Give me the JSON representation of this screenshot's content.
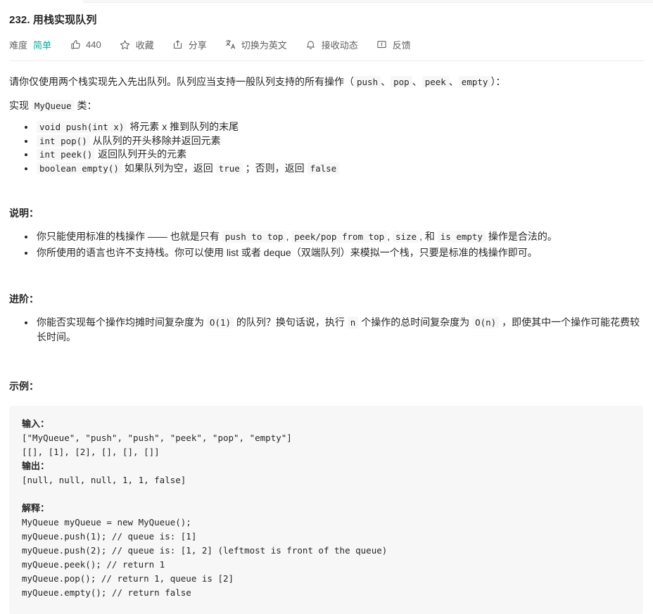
{
  "header": {
    "title": "232. 用栈实现队列",
    "toolbar": {
      "difficulty_label": "难度",
      "difficulty_value": "简单",
      "like_icon": "thumbs-up-icon",
      "like_count": "440",
      "favorite_icon": "star-icon",
      "favorite_label": "收藏",
      "share_icon": "share-icon",
      "share_label": "分享",
      "translate_icon": "translate-icon",
      "translate_label": "切换为英文",
      "subscribe_icon": "bell-icon",
      "subscribe_label": "接收动态",
      "feedback_icon": "comment-icon",
      "feedback_label": "反馈"
    }
  },
  "intro": {
    "line1_a": "请你仅使用两个栈实现先入先出队列。队列应当支持一般队列支持的所有操作（",
    "code_push": "push",
    "sep1": "、",
    "code_pop": "pop",
    "sep2": "、",
    "code_peek": "peek",
    "sep3": "、",
    "code_empty": "empty",
    "line1_b": "）：",
    "line2_a": "实现 ",
    "code_myqueue": "MyQueue",
    "line2_b": " 类："
  },
  "methods": [
    {
      "sig": "void push(int x)",
      "desc": " 将元素 x 推到队列的末尾"
    },
    {
      "sig": "int pop()",
      "desc": " 从队列的开头移除并返回元素"
    },
    {
      "sig": "int peek()",
      "desc": " 返回队列开头的元素"
    },
    {
      "sig": "boolean empty()",
      "desc_a": " 如果队列为空，返回 ",
      "code_true": "true",
      "desc_b": " ；否则，返回 ",
      "code_false": "false"
    }
  ],
  "notes": {
    "heading": "说明：",
    "item1_a": "你只能使用标准的栈操作 —— 也就是只有 ",
    "item1_code1": "push to top",
    "item1_b": ", ",
    "item1_code2": "peek/pop from top",
    "item1_c": ", ",
    "item1_code3": "size",
    "item1_d": ", 和 ",
    "item1_code4": "is empty",
    "item1_e": " 操作是合法的。",
    "item2_a": "你所使用的语言也许不支持栈。你可以使用 list 或者 deque（双端队列）来模拟一个栈，只要是标准的栈操作即可。"
  },
  "advanced": {
    "heading": "进阶：",
    "item_a": "你能否实现每个操作均摊时间复杂度为 ",
    "item_code1": "O(1)",
    "item_b": " 的队列？换句话说，执行 ",
    "item_code2": "n",
    "item_c": " 个操作的总时间复杂度为 ",
    "item_code3": "O(n)",
    "item_d": " ，即使其中一个操作可能花费较长时间。"
  },
  "example": {
    "heading": "示例：",
    "input_label": "输入：",
    "input_lines": [
      "[\"MyQueue\", \"push\", \"push\", \"peek\", \"pop\", \"empty\"]",
      "[[], [1], [2], [], [], []]"
    ],
    "output_label": "输出：",
    "output_lines": [
      "[null, null, null, 1, 1, false]"
    ],
    "explain_label": "解释：",
    "explain_lines": [
      "MyQueue myQueue = new MyQueue();",
      "myQueue.push(1); // queue is: [1]",
      "myQueue.push(2); // queue is: [1, 2] (leftmost is front of the queue)",
      "myQueue.peek(); // return 1",
      "myQueue.pop(); // return 1, queue is [2]",
      "myQueue.empty(); // return false"
    ]
  },
  "colors": {
    "difficulty_green": "#00af9b",
    "code_bg": "#f7f7f7",
    "text": "#262626",
    "divider": "#ebebeb"
  }
}
